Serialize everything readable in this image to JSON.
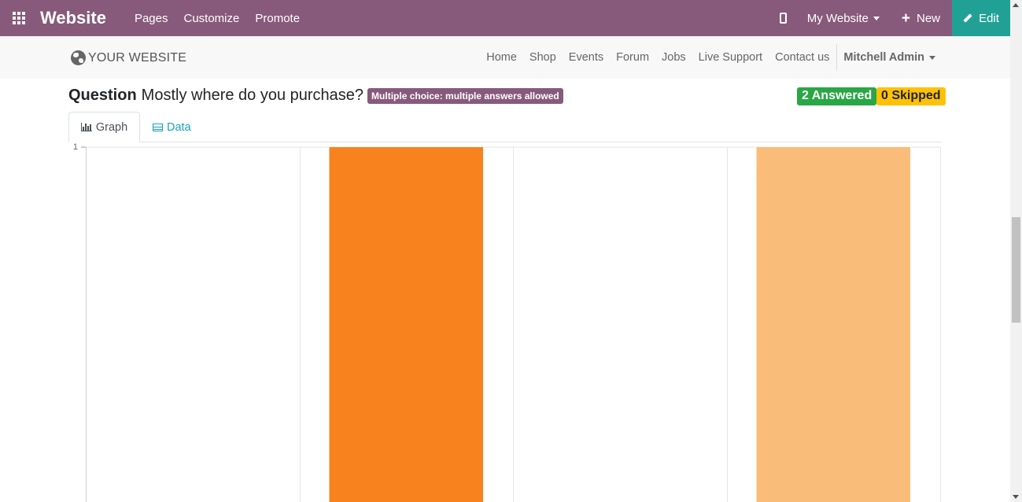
{
  "topbar": {
    "app_icon": "apps-grid-icon",
    "brand": "Website",
    "menu": [
      "Pages",
      "Customize",
      "Promote"
    ],
    "mobile_icon": "mobile-preview-icon",
    "website_switcher": "My Website",
    "new_label": "New",
    "edit_label": "Edit",
    "colors": {
      "background": "#875a7b",
      "edit": "#21a196"
    }
  },
  "site_header": {
    "logo_text": "YOUR WEBSITE",
    "logo_icon": "globe-icon",
    "nav": [
      "Home",
      "Shop",
      "Events",
      "Forum",
      "Jobs",
      "Live Support",
      "Contact us"
    ],
    "user": "Mitchell Admin"
  },
  "question": {
    "prefix": "Question",
    "text": "Mostly where do you purchase?",
    "type_badge": "Multiple choice: multiple answers allowed",
    "answered": "2 Answered",
    "skipped": "0 Skipped",
    "colors": {
      "badge": "#875a7b",
      "answered": "#28a745",
      "skipped": "#ffc107"
    }
  },
  "tabs": {
    "graph": "Graph",
    "data": "Data",
    "active": "Graph"
  },
  "chart_data": {
    "type": "bar",
    "categories": [
      "",
      "",
      "",
      ""
    ],
    "values": [
      0,
      1,
      0,
      1
    ],
    "colors": [
      "#1f77b4",
      "#f8821e",
      "#ffbb78",
      "#fabd79"
    ],
    "ylim": [
      0,
      1
    ],
    "y_ticks": [
      "1"
    ],
    "grid": true
  }
}
